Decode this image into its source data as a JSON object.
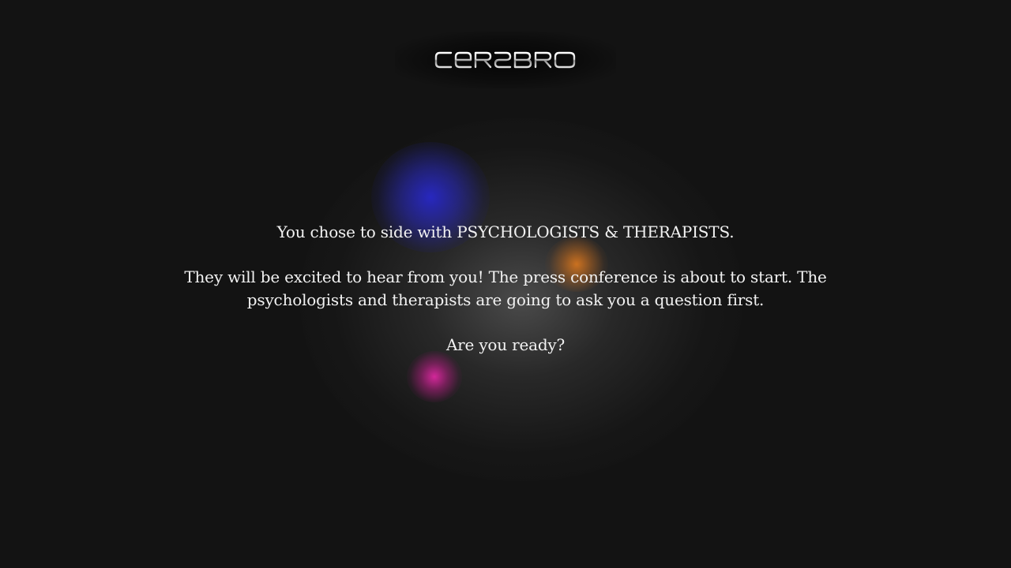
{
  "logo": {
    "text": "CEREBRO",
    "icon": "cerebro-wordmark"
  },
  "message": {
    "line1": "You chose to side with PSYCHOLOGISTS & THERAPISTS.",
    "line2": "They will be excited to hear from you! The press conference is about to start. The psychologists and therapists are going to ask you a question first.",
    "line3": "Are you ready?"
  },
  "colors": {
    "background": "#131313",
    "text": "#f2f2f2",
    "blob_blue": "#2828c8",
    "blob_orange": "#dc781e",
    "blob_magenta": "#dc28a0"
  }
}
